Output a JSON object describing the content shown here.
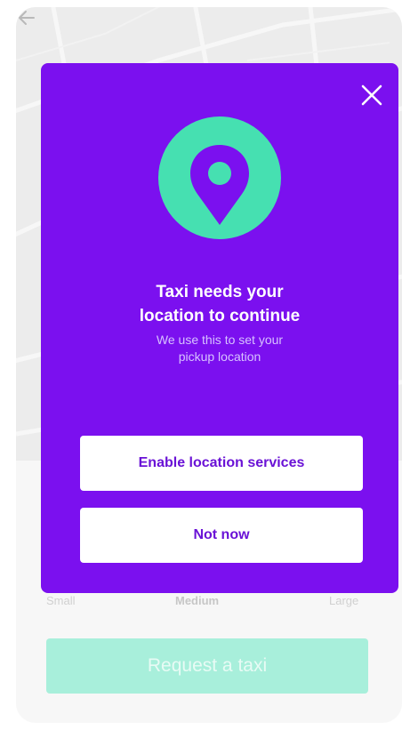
{
  "background": {
    "sizes": {
      "small": "Small",
      "medium": "Medium",
      "large": "Large"
    },
    "request_button": "Request a taxi",
    "accent_color": "#a8efdb"
  },
  "modal": {
    "title": "Taxi needs your\nlocation to continue",
    "subtitle": "We use this to set your\npickup location",
    "enable_button": "Enable location services",
    "not_now_button": "Not now",
    "close_icon": "close-icon",
    "pin_icon": "location-pin-icon",
    "background_color": "#7b10ef",
    "pin_color": "#46e0b1"
  }
}
